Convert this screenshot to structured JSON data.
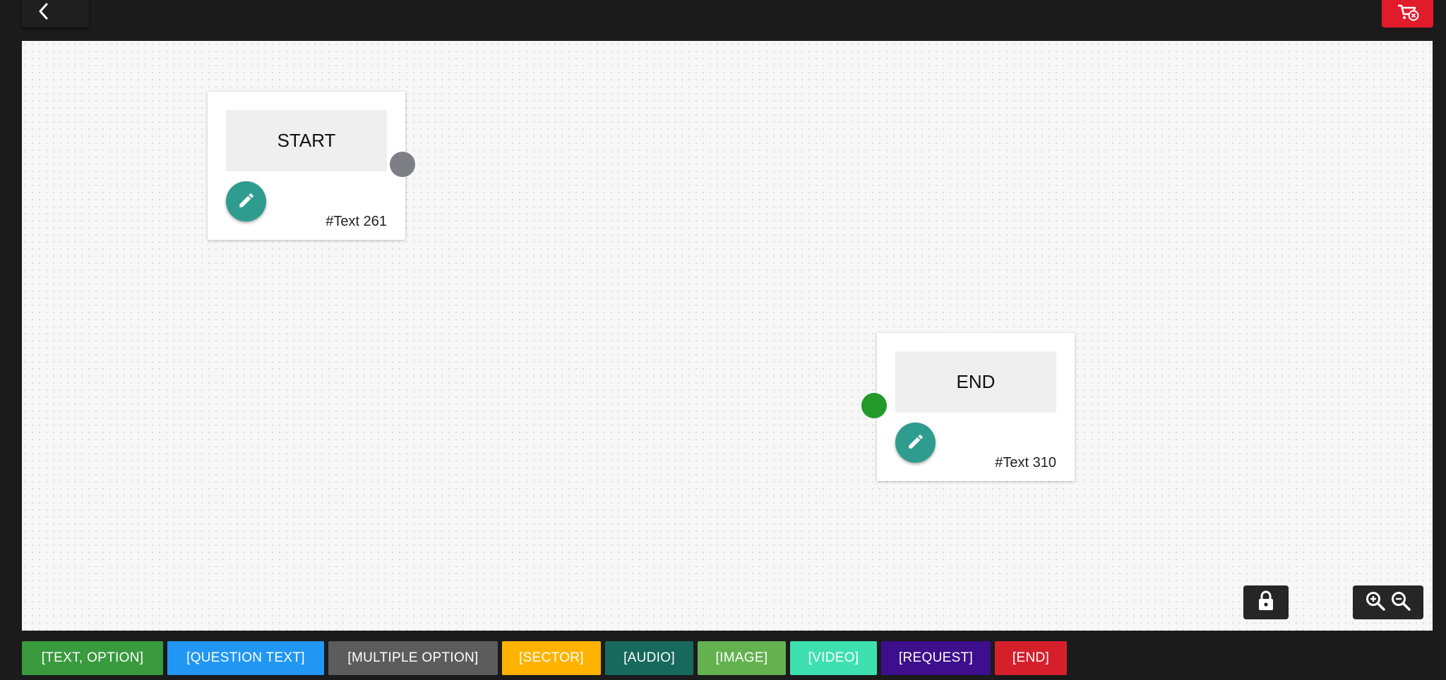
{
  "header": {
    "back_icon": "chevron-left-icon",
    "exit_icon": "cart-cancel-icon",
    "exit_color": "#e21b2b"
  },
  "canvas": {
    "nodes": [
      {
        "title": "START",
        "id_label": "#Text 261",
        "port_color": "#7d7f84"
      },
      {
        "title": "END",
        "id_label": "#Text 310",
        "port_color": "#22992a"
      }
    ],
    "tools": {
      "lock_icon": "lock-icon",
      "zoom_in_icon": "zoom-in-icon",
      "zoom_out_icon": "zoom-out-icon"
    }
  },
  "node_types": [
    {
      "label": "[TEXT, OPTION]",
      "color": "#3a9a3e"
    },
    {
      "label": "[QUESTION TEXT]",
      "color": "#2196f3"
    },
    {
      "label": "[MULTIPLE OPTION]",
      "color": "#5c5c5c"
    },
    {
      "label": "[SECTOR]",
      "color": "#ffb300"
    },
    {
      "label": "[AUDIO]",
      "color": "#16695c"
    },
    {
      "label": "[IMAGE]",
      "color": "#63b24f"
    },
    {
      "label": "[VIDEO]",
      "color": "#3fe0b0"
    },
    {
      "label": "[REQUEST]",
      "color": "#3d0f8c"
    },
    {
      "label": "[END]",
      "color": "#d5202c"
    }
  ]
}
